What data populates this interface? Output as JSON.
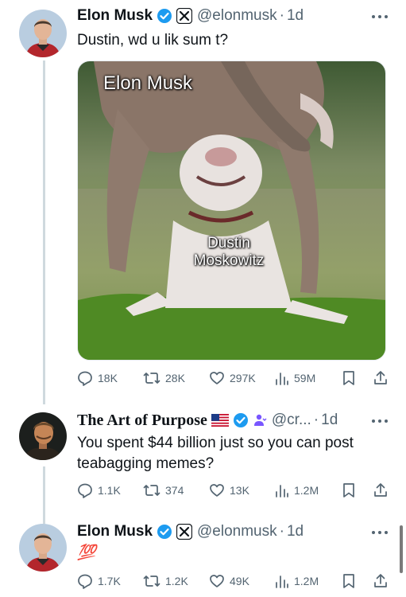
{
  "tweets": [
    {
      "name": "Elon Musk",
      "handle": "@elonmusk",
      "separator": "·",
      "time": "1d",
      "text": "Dustin, wd u lik sum t?",
      "media": {
        "label_top": "Elon Musk",
        "label_middle": "Dustin Moskowitz"
      },
      "stats": {
        "replies": "18K",
        "reposts": "28K",
        "likes": "297K",
        "views": "59M"
      }
    },
    {
      "name": "The Art of Purpose",
      "handle": "@cr...",
      "separator": "·",
      "time": "1d",
      "text": "You spent $44 billion just so you can post teabagging memes?",
      "stats": {
        "replies": "1.1K",
        "reposts": "374",
        "likes": "13K",
        "views": "1.2M"
      }
    },
    {
      "name": "Elon Musk",
      "handle": "@elonmusk",
      "separator": "·",
      "time": "1d",
      "text": "💯",
      "stats": {
        "replies": "1.7K",
        "reposts": "1.2K",
        "likes": "49K",
        "views": "1.2M"
      }
    }
  ],
  "colors": {
    "verified": "#1d9bf0",
    "secondary_text": "#536471",
    "thread_line": "#cfd9de"
  },
  "icons": [
    "verified-badge-icon",
    "x-logo-icon",
    "us-flag-icon",
    "affiliate-icon",
    "more-icon",
    "reply-icon",
    "repost-icon",
    "like-icon",
    "views-icon",
    "bookmark-icon",
    "share-icon"
  ]
}
